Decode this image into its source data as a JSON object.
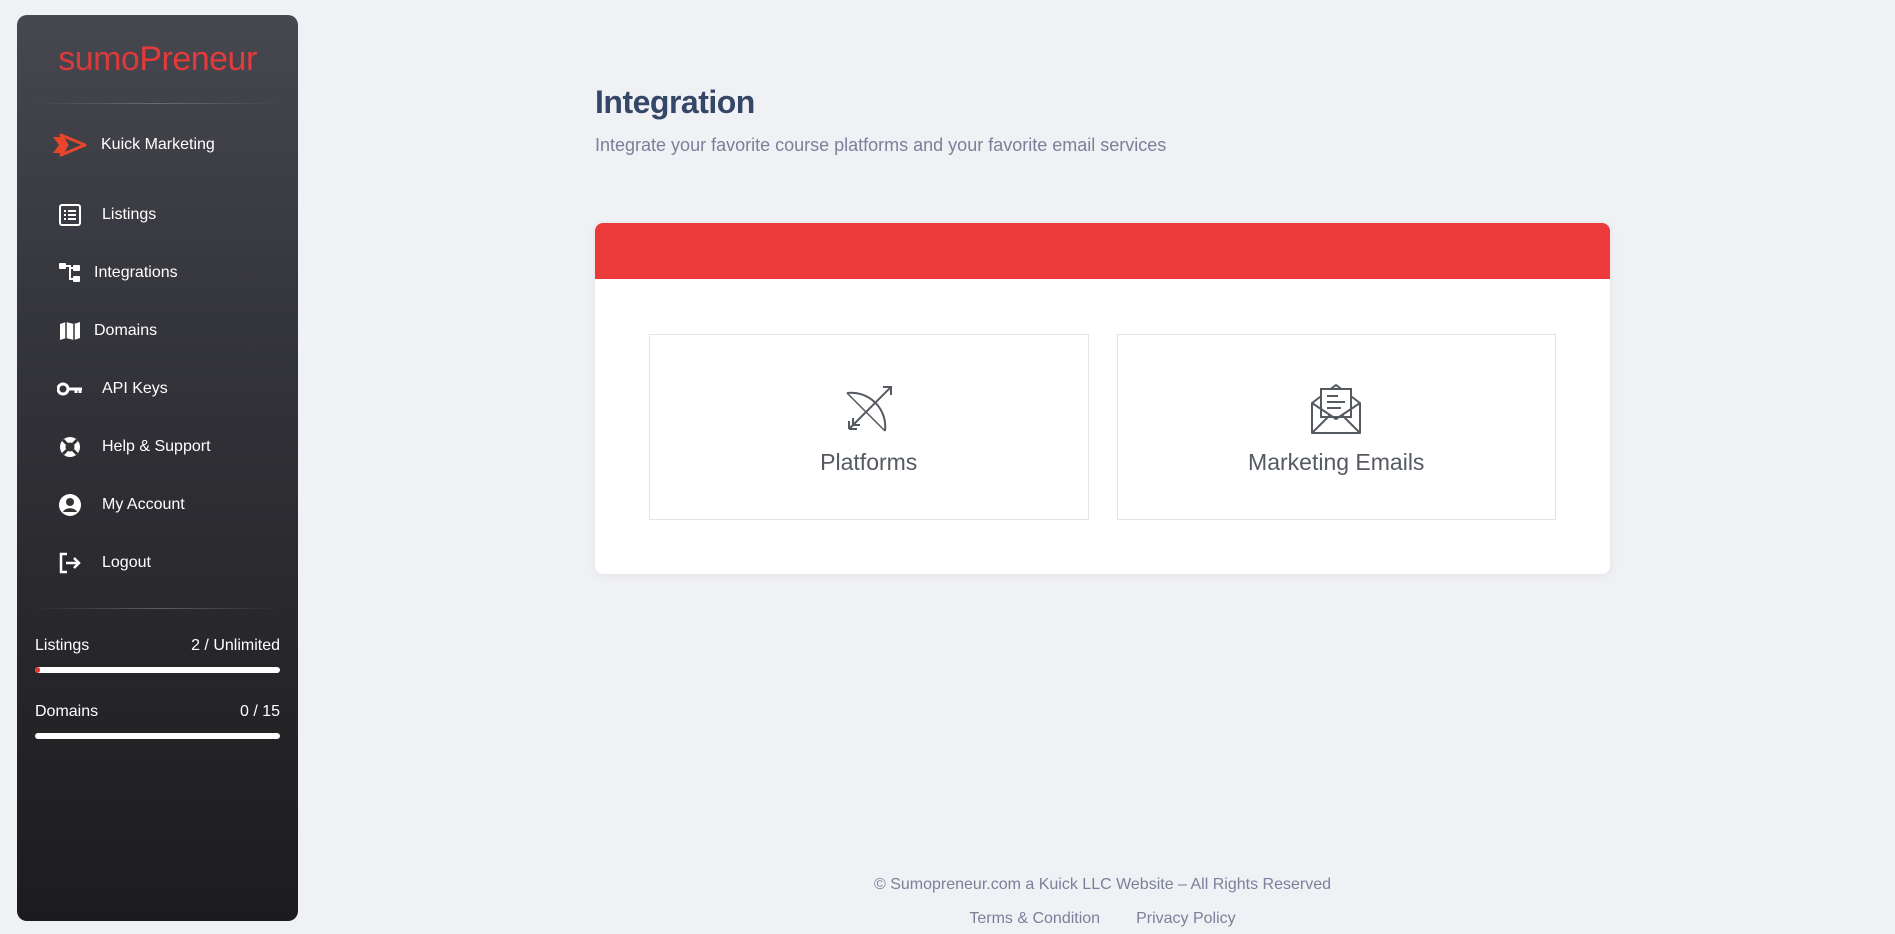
{
  "sidebar": {
    "logo": {
      "part1": "sumo",
      "part2": "Preneur"
    },
    "brand": {
      "label": "Kuick Marketing",
      "icon": "kuick-arrow-icon"
    },
    "items": [
      {
        "label": "Listings",
        "icon": "list-icon"
      },
      {
        "label": "Integrations",
        "icon": "sitemap-icon"
      },
      {
        "label": "Domains",
        "icon": "map-icon"
      },
      {
        "label": "API Keys",
        "icon": "key-icon"
      },
      {
        "label": "Help & Support",
        "icon": "lifebuoy-icon"
      },
      {
        "label": "My Account",
        "icon": "user-circle-icon"
      },
      {
        "label": "Logout",
        "icon": "logout-icon"
      }
    ],
    "stats": [
      {
        "label": "Listings",
        "value": "2 / Unlimited",
        "progress": 0.02
      },
      {
        "label": "Domains",
        "value": "0 / 15",
        "progress": 0
      }
    ]
  },
  "main": {
    "title": "Integration",
    "subtitle": "Integrate your favorite course platforms and your favorite email services",
    "tiles": [
      {
        "label": "Platforms",
        "icon": "bow-arrow-icon"
      },
      {
        "label": "Marketing Emails",
        "icon": "open-envelope-icon"
      }
    ]
  },
  "footer": {
    "copyright": "© Sumopreneur.com a Kuick LLC Website – All Rights Reserved",
    "links": [
      "Terms & Condition",
      "Privacy Policy"
    ]
  },
  "colors": {
    "accent": "#ec3a3a",
    "title": "#344767",
    "muted": "#7b809a"
  }
}
